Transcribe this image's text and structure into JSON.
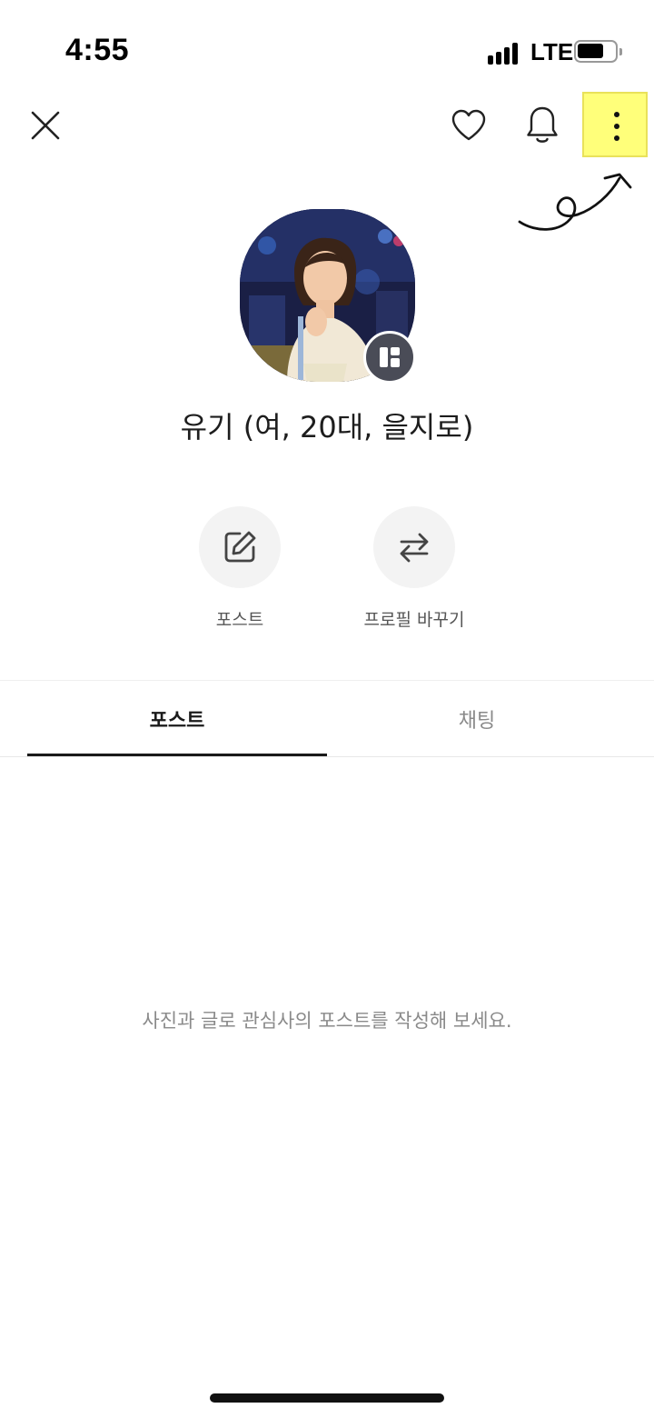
{
  "status_bar": {
    "time": "4:55",
    "network": "LTE",
    "battery_level": 0.7,
    "signal_icon": "signal-bars-icon"
  },
  "top_nav": {
    "close_icon": "close-icon",
    "heart_icon": "heart-icon",
    "bell_icon": "bell-icon",
    "more_icon": "more-vertical-icon",
    "highlight_color": "#ffff7a"
  },
  "profile": {
    "name": "유기 (여, 20대, 을지로)",
    "badge_icon": "profile-layout-icon"
  },
  "actions": [
    {
      "label": "포스트",
      "icon": "edit-icon"
    },
    {
      "label": "프로필 바꾸기",
      "icon": "swap-arrows-icon"
    }
  ],
  "tabs": [
    {
      "label": "포스트",
      "active": true
    },
    {
      "label": "채팅",
      "active": false
    }
  ],
  "empty_state": {
    "message": "사진과 글로 관심사의 포스트를 작성해 보세요."
  }
}
